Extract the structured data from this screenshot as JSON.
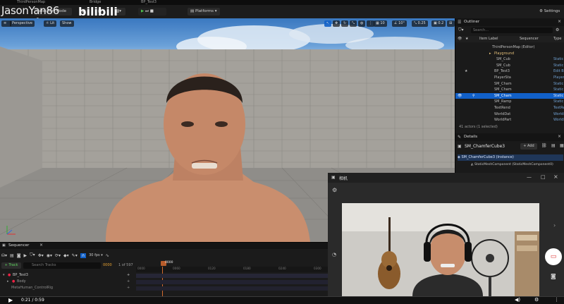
{
  "tabs": [
    "ThirdPersonMap",
    "Bridge",
    "BP_Test3"
  ],
  "toolbar": {
    "selection_mode": "Selection Mode",
    "platforms": "Platforms",
    "settings": "Settings"
  },
  "watermark": {
    "name": "JasonYan86",
    "logo": "bilibili"
  },
  "viewport": {
    "perspective": "Perspective",
    "lit": "Lit",
    "show": "Show",
    "grid_snap": "10",
    "angle_snap": "10°",
    "scale_snap": "0.25",
    "camera_speed": "0.2"
  },
  "outliner": {
    "title": "Outliner",
    "search_placeholder": "Search...",
    "col_label": "Item Label",
    "col_sequencer": "Sequencer",
    "col_type": "Type",
    "rows": [
      {
        "label": "ThirdPersonMap (Editor)",
        "type": ""
      },
      {
        "label": "Playground",
        "type": ""
      },
      {
        "label": "SM_Cub",
        "type": "Static"
      },
      {
        "label": "SM_Cub",
        "type": "Static"
      },
      {
        "label": "BP_Test3",
        "type": "Edit B"
      },
      {
        "label": "PlayerSta",
        "type": "PlayerSt"
      },
      {
        "label": "SM_Cham",
        "type": "Static"
      },
      {
        "label": "SM_Cham",
        "type": "Static"
      },
      {
        "label": "SM_Cham",
        "type": "Static"
      },
      {
        "label": "SM_Ramp",
        "type": "Static"
      },
      {
        "label": "TextRend",
        "type": "TextRen"
      },
      {
        "label": "WorldDat",
        "type": "WorldD"
      },
      {
        "label": "WorldPart",
        "type": "WorldP"
      }
    ],
    "footer": "41 actors (1 selected)"
  },
  "details": {
    "title": "Details",
    "object_name": "SM_ChamferCube3",
    "add_label": "+ Add",
    "instance": "SM_ChamferCube3 (Instance)",
    "component": "StaticMeshComponent (StaticMeshComponent0)",
    "edit": "Edit"
  },
  "sequencer": {
    "title": "Sequencer",
    "fps": "30 fps",
    "add_track": "+ Track",
    "search_placeholder": "Search Tracks",
    "current_frame": "0000",
    "frame_count": "1 of 597",
    "playhead": "0000",
    "tracks": [
      "BP_Test3",
      "Body",
      "MetaHuman_ControlRig"
    ],
    "ticks": [
      "0000",
      "0060",
      "0120",
      "0180",
      "0240",
      "0300"
    ]
  },
  "cam": {
    "title": "相机"
  },
  "player": {
    "time": "0:21 / 0:59"
  }
}
